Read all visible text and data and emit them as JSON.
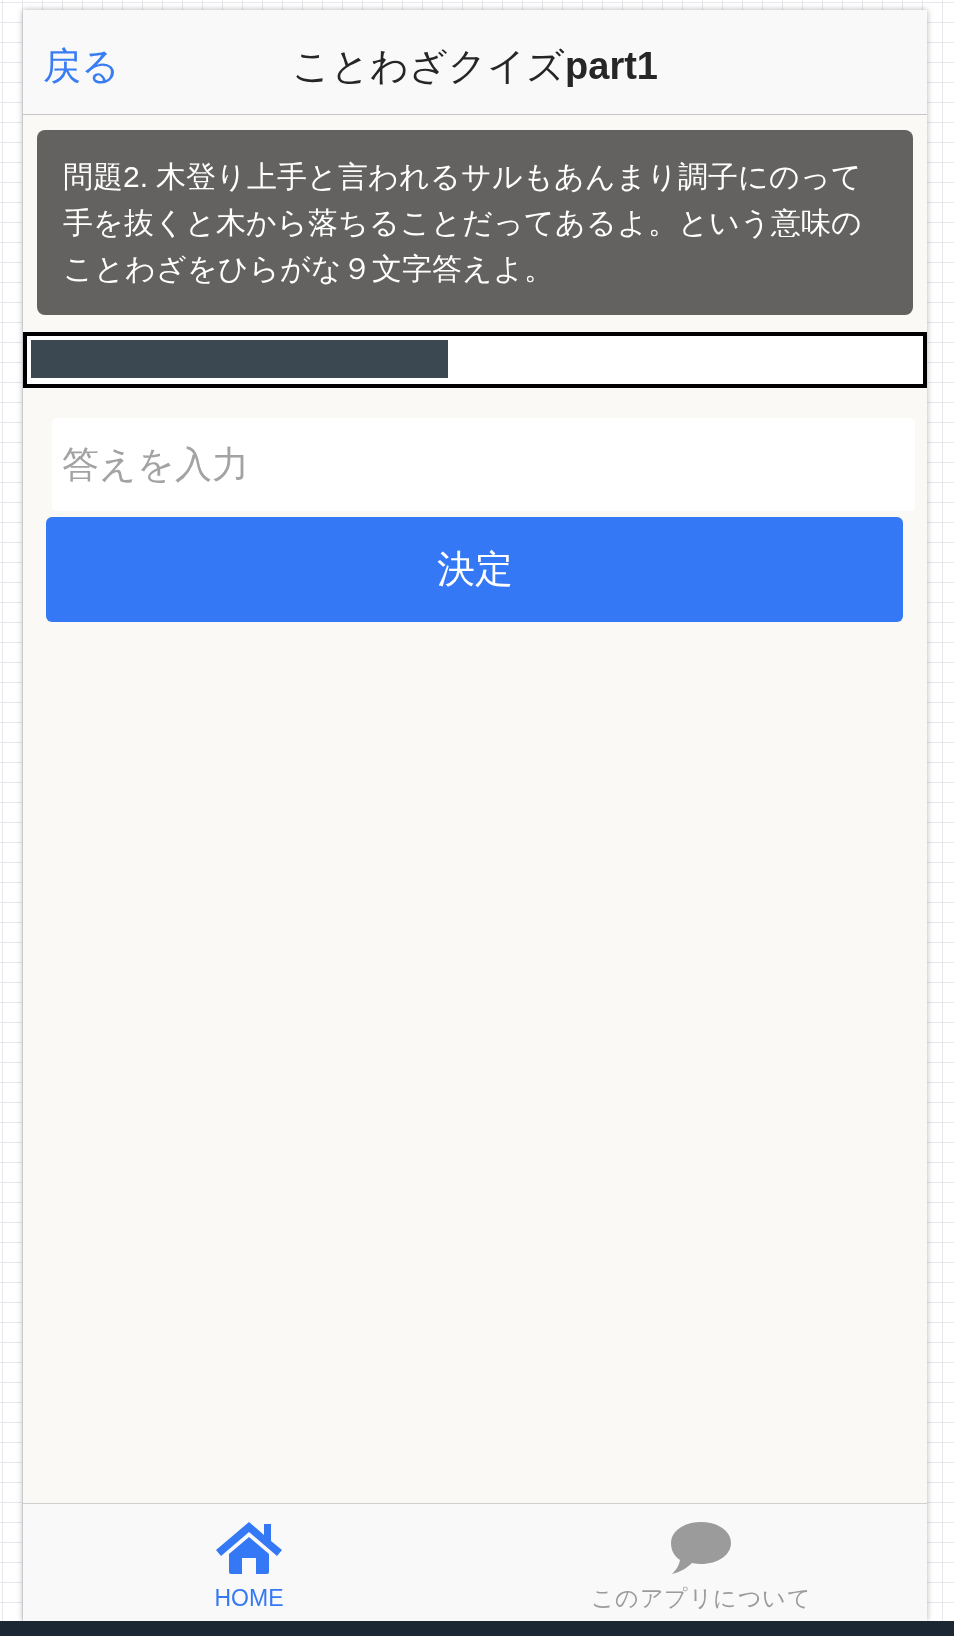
{
  "header": {
    "back_button": "戻る",
    "title": "ことわざクイズ**part1**"
  },
  "question": {
    "text": "問題2. 木登り上手と言われるサルもあんまり調子にのって手を抜くと木から落ちることだってあるよ。という意味のことわざをひらがな９文字答えよ。"
  },
  "progress_bar": {
    "level": 0.47
  },
  "answer_field": {
    "placeholder": "答えを入力"
  },
  "submit_button": "決定",
  "tab_bar": [
    {
      "label": "HOME",
      "selected": true
    },
    {
      "label": "このアプリについて",
      "selected": false
    }
  ]
}
